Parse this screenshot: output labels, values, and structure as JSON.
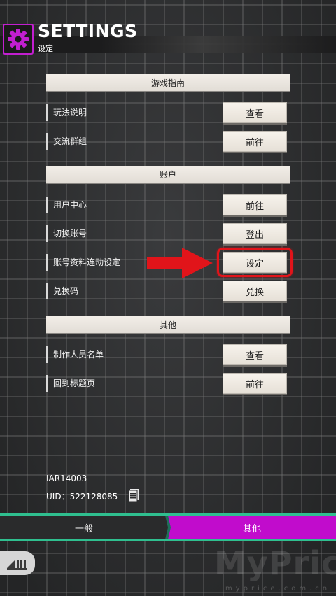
{
  "header": {
    "title": "SETTINGS",
    "subtitle": "设定",
    "icon": "gear-icon",
    "accent": "#c21fd0"
  },
  "sections": {
    "guide": {
      "title": "游戏指南",
      "rows": [
        {
          "label": "玩法说明",
          "button": "查看"
        },
        {
          "label": "交流群组",
          "button": "前往"
        }
      ]
    },
    "account": {
      "title": "账户",
      "rows": [
        {
          "label": "用户中心",
          "button": "前往"
        },
        {
          "label": "切换账号",
          "button": "登出"
        },
        {
          "label": "账号资料连动设定",
          "button": "设定"
        },
        {
          "label": "兑换码",
          "button": "兑换"
        }
      ]
    },
    "other": {
      "title": "其他",
      "rows": [
        {
          "label": "制作人员名单",
          "button": "查看"
        },
        {
          "label": "回到标题页",
          "button": "前往"
        }
      ]
    }
  },
  "info": {
    "version": "IAR14003",
    "uid": "UID：522128085"
  },
  "tabs": {
    "general": "一般",
    "other": "其他",
    "active_color": "#c10ccc"
  },
  "annotation": {
    "arrow_color": "#e1141a"
  },
  "watermark": {
    "text": "MyPrice",
    "sub": "myprice.com.cn"
  }
}
